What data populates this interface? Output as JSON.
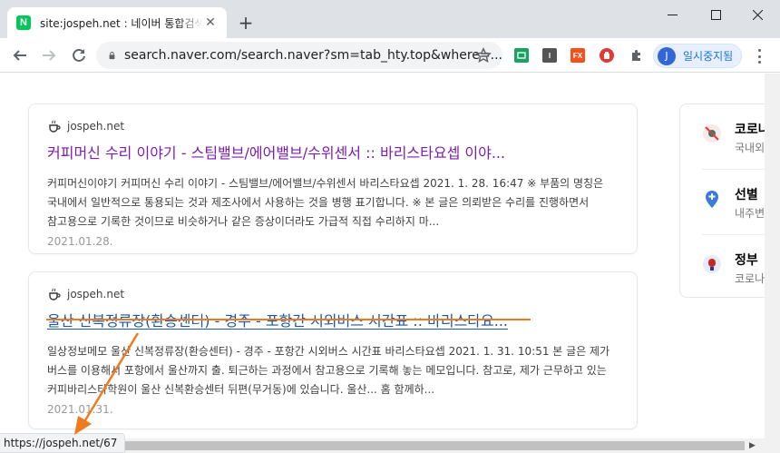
{
  "browser": {
    "tab": {
      "favicon": "N",
      "title": "site:jospeh.net : 네이버 통합검색",
      "close": "✕"
    },
    "new_tab": "+",
    "window": {
      "minimize": "—",
      "maximize": "☐",
      "close": "✕"
    },
    "address": "search.naver.com/search.naver?sm=tab_hty.top&where=...",
    "profile": {
      "initial": "J",
      "label": "일시중지됨"
    },
    "extensions": [
      {
        "name": "screen-capture-icon",
        "color": "#1aa260",
        "text": ""
      },
      {
        "name": "instapaper-icon",
        "color": "#555555",
        "text": "I"
      },
      {
        "name": "fx-icon",
        "color": "#f4511e",
        "text": "FX"
      },
      {
        "name": "adblock-icon",
        "color": "#e53935",
        "text": ""
      }
    ]
  },
  "results": [
    {
      "source": "jospeh.net",
      "title": "커피머신 수리 이야기 - 스팀밸브/에어밸브/수위센서 :: 바리스타요셉 이야...",
      "desc": "커피머신이야기 커피머신 수리 이야기 - 스팀밸브/에어밸브/수위센서 바리스타요셉 2021. 1. 28. 16:47 ※ 부품의 명칭은 국내에서 일반적으로 통용되는 것과 제조사에서 사용하는 것을 병행 표기합니다. ※ 본 글은 의뢰받은 수리를 진행하면서 참고용으로 기록한 것이므로 비슷하거나 같은 증상이더라도 가급적 직접 수리하지 마...",
      "date": "2021.01.28."
    },
    {
      "source": "jospeh.net",
      "title": "울산 신복정류장(환승센터) - 경주 - 포항간 시외버스 시간표 :: 바리스타요...",
      "desc": "일상정보메모 울산 신복정류장(환승센터) - 경주 - 포항간 시외버스 시간표 바리스타요셉 2021. 1. 31. 10:51 본 글은 제가 버스를 이용해서 포항에서 울산까지 출. 퇴근하는 과정에서 참고용으로 기록해 놓는 메모입니다. 참고로, 제가 근무하고 있는 커피바리스타학원이 울산 신복환승센터 뒤편(무거동)에 있습니다. 울산... 홈 함께하...",
      "date": "2021.01.31."
    }
  ],
  "side": [
    {
      "title": "코로나",
      "sub": "국내외"
    },
    {
      "title": "선별",
      "sub": "내주변"
    },
    {
      "title": "정부",
      "sub": "코로나"
    }
  ],
  "status_url": "https://jospeh.net/67",
  "colors": {
    "visited": "#7c1db0",
    "link": "#1a57a6",
    "annotation": "#f07a1e"
  }
}
